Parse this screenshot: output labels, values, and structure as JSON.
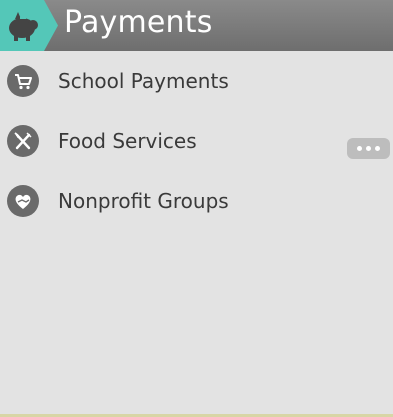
{
  "header": {
    "title": "Payments",
    "icon": "piggy-bank-icon",
    "accent_color": "#54c7b8"
  },
  "menu": {
    "items": [
      {
        "label": "School Payments",
        "icon": "cart-icon"
      },
      {
        "label": "Food Services",
        "icon": "fork-knife-icon"
      },
      {
        "label": "Nonprofit Groups",
        "icon": "heart-hand-icon"
      }
    ],
    "more_icon": "more-dots-icon"
  },
  "colors": {
    "background": "#e3e3e3",
    "header": "#7a7a7a",
    "icon": "#6a6a6a",
    "text": "#3a3a3a"
  }
}
